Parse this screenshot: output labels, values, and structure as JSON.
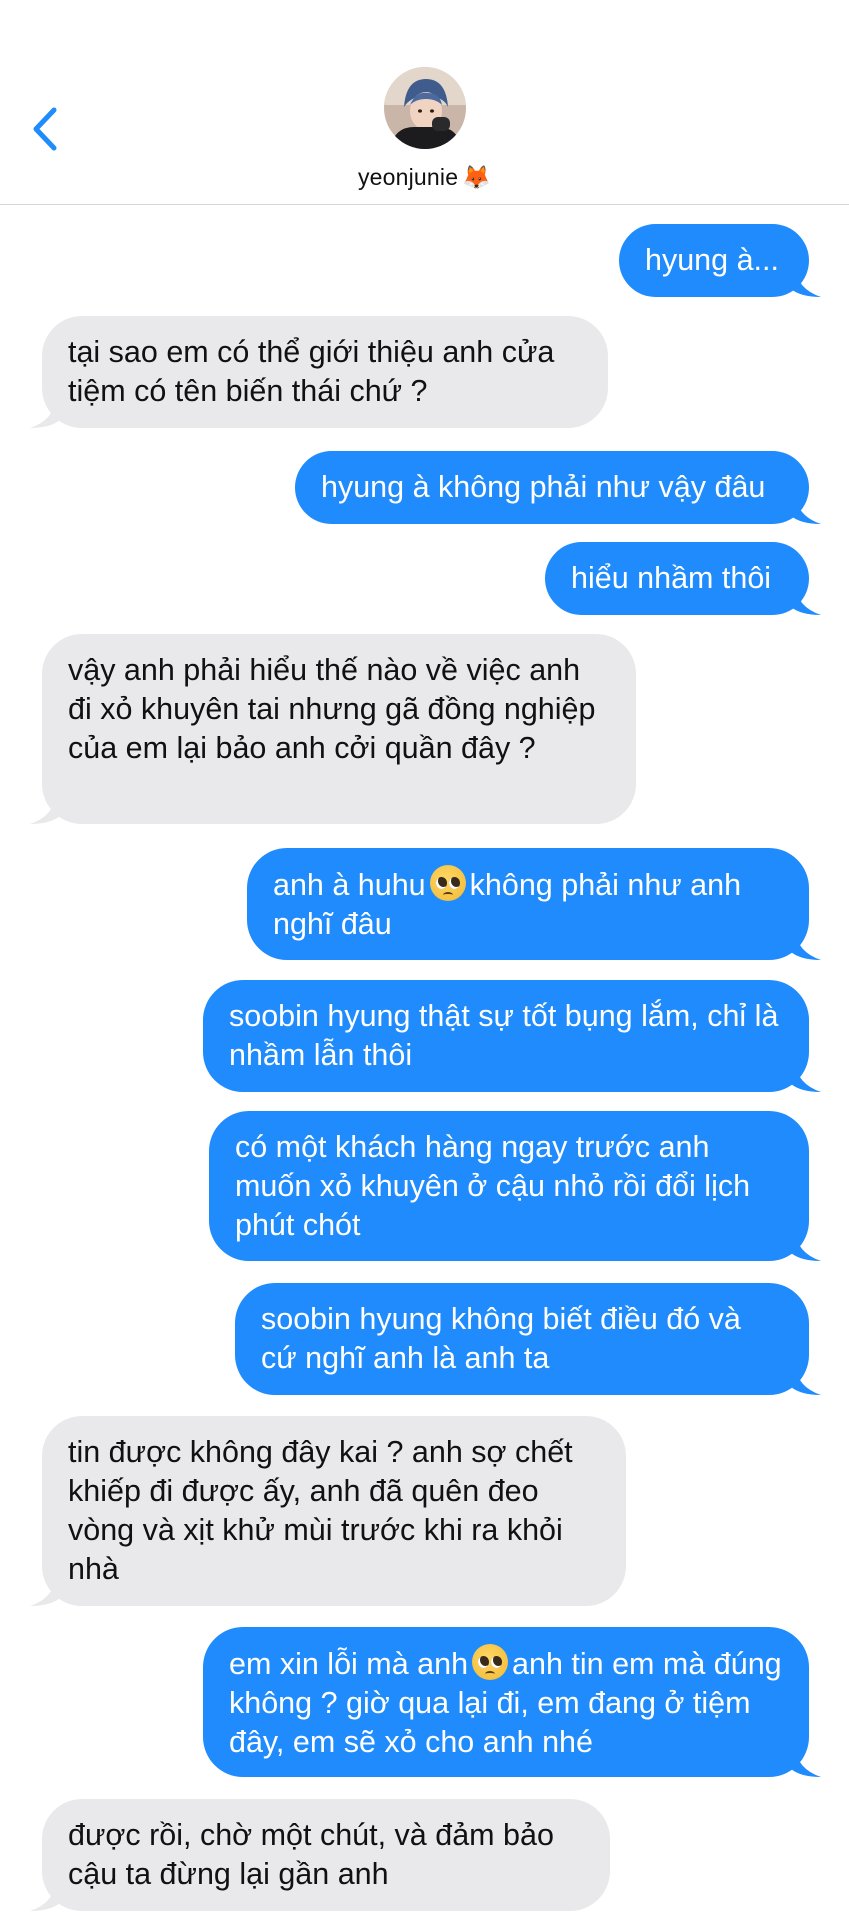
{
  "header": {
    "contact_name": "yeonjunie",
    "contact_emoji": "🦊",
    "back_icon": "chevron-left-icon",
    "accent": "#1f8bfc"
  },
  "colors": {
    "sent_bubble": "#1f8bfc",
    "received_bubble": "#e9e9eb"
  },
  "messages": [
    {
      "dir": "sent",
      "text": "hyung à..."
    },
    {
      "dir": "received",
      "text": "tại sao em có thể giới thiệu anh cửa tiệm có tên biến thái chứ ?"
    },
    {
      "dir": "sent",
      "text": "hyung à không phải như vậy đâu"
    },
    {
      "dir": "sent",
      "text": "hiểu nhầm thôi"
    },
    {
      "dir": "received",
      "text": "vậy anh phải hiểu thế nào về việc anh đi xỏ khuyên tai nhưng gã đồng nghiệp của em lại bảo anh cởi quần đây ?"
    },
    {
      "dir": "sent",
      "text_a": "anh à huhu",
      "emoji": "pleading-face-emoji",
      "text_b": "không phải như anh nghĩ đâu"
    },
    {
      "dir": "sent",
      "text": "soobin hyung thật sự tốt bụng lắm, chỉ là nhầm lẫn thôi"
    },
    {
      "dir": "sent",
      "text": "có một khách hàng ngay trước anh muốn xỏ khuyên ở cậu nhỏ rồi đổi lịch phút chót"
    },
    {
      "dir": "sent",
      "text": "soobin hyung không biết điều đó và cứ nghĩ anh là anh ta"
    },
    {
      "dir": "received",
      "text": "tin được không đây kai ? anh sợ chết khiếp đi được ấy, anh đã quên đeo vòng và xịt khử mùi trước khi ra khỏi nhà"
    },
    {
      "dir": "sent",
      "text_a": "em xin lỗi mà anh",
      "emoji": "pleading-face-emoji",
      "text_b": "anh tin em mà đúng không ? giờ qua lại đi, em đang ở tiệm đây, em sẽ xỏ cho anh nhé"
    },
    {
      "dir": "received",
      "text": "được rồi, chờ một chút, và đảm bảo cậu ta đừng lại gần anh"
    }
  ]
}
